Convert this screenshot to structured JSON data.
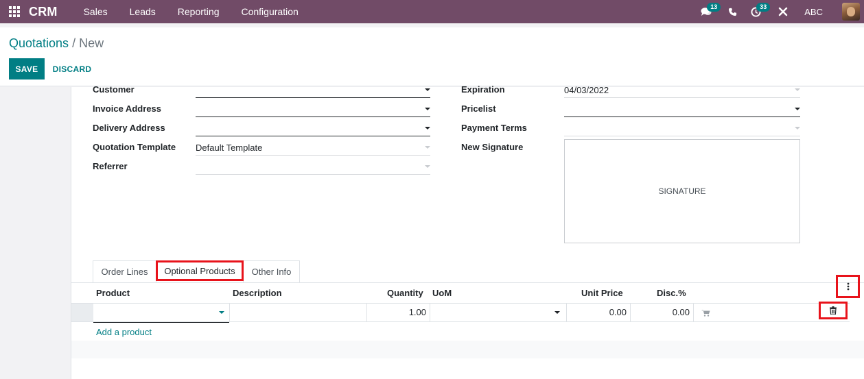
{
  "navbar": {
    "app_name": "CRM",
    "menu": [
      "Sales",
      "Leads",
      "Reporting",
      "Configuration"
    ],
    "messages_count": "13",
    "activities_count": "33",
    "company": "ABC",
    "icons": [
      "apps-grid-icon",
      "chat-icon",
      "phone-icon",
      "clock-icon",
      "tools-icon",
      "avatar"
    ],
    "color": "#714b67"
  },
  "breadcrumb": {
    "parent": "Quotations",
    "separator": "/",
    "current": "New"
  },
  "buttons": {
    "save": "SAVE",
    "discard": "DISCARD"
  },
  "form": {
    "left": {
      "customer_label": "Customer",
      "customer_value": "",
      "invoice_address_label": "Invoice Address",
      "invoice_address_value": "",
      "delivery_address_label": "Delivery Address",
      "delivery_address_value": "",
      "quotation_template_label": "Quotation Template",
      "quotation_template_value": "Default Template",
      "referrer_label": "Referrer",
      "referrer_value": ""
    },
    "right": {
      "expiration_label": "Expiration",
      "expiration_value": "04/03/2022",
      "pricelist_label": "Pricelist",
      "pricelist_value": "",
      "payment_terms_label": "Payment Terms",
      "payment_terms_value": "",
      "new_signature_label": "New Signature",
      "signature_placeholder": "SIGNATURE"
    }
  },
  "tabs": {
    "order_lines": "Order Lines",
    "optional_products": "Optional Products",
    "other_info": "Other Info",
    "active": "Optional Products"
  },
  "table": {
    "headers": {
      "product": "Product",
      "description": "Description",
      "quantity": "Quantity",
      "uom": "UoM",
      "unit_price": "Unit Price",
      "discount": "Disc.%"
    },
    "rows": [
      {
        "product": "",
        "description": "",
        "quantity": "1.00",
        "uom": "",
        "unit_price": "0.00",
        "discount": "0.00"
      }
    ],
    "add_product": "Add a product"
  },
  "accent_color": "#017e84",
  "highlight_color": "#e8131b"
}
